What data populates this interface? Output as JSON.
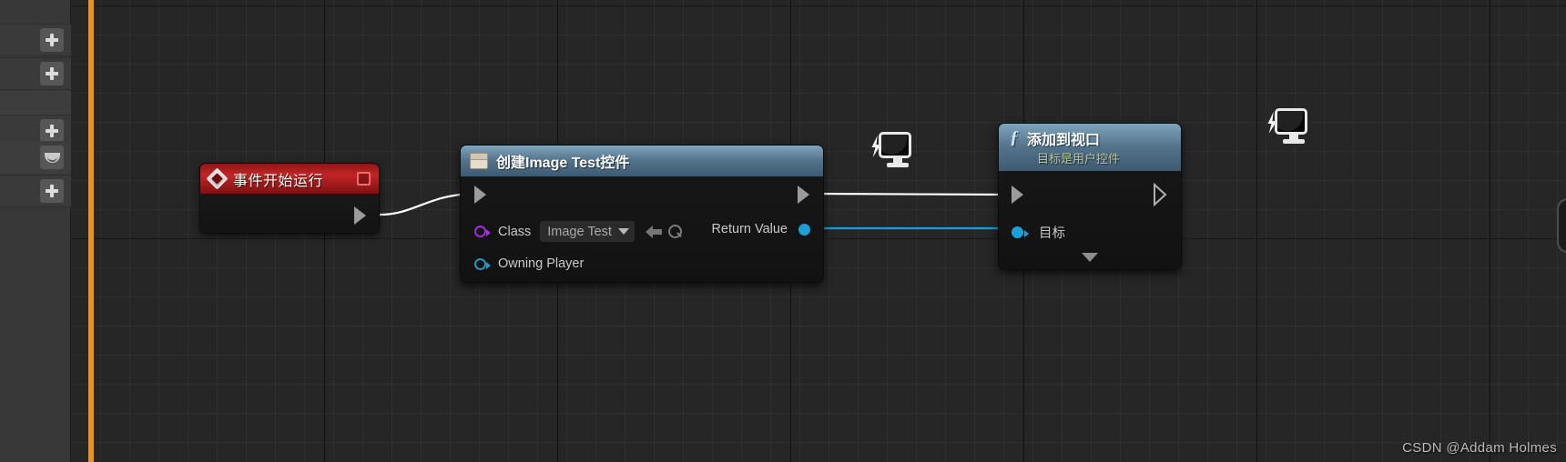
{
  "app": {
    "watermark": "CSDN @Addam Holmes"
  },
  "sidebar": {
    "items": [
      {
        "name": "add-row-1",
        "icon": "plus-icon"
      },
      {
        "name": "add-row-2",
        "icon": "plus-icon"
      },
      {
        "name": "spacer-row",
        "icon": "none"
      },
      {
        "name": "add-row-3",
        "icon": "plus-icon"
      },
      {
        "name": "visibility-row",
        "icon": "eye-icon"
      },
      {
        "name": "add-row-4",
        "icon": "plus-icon"
      }
    ]
  },
  "graph": {
    "axis_color": "#e8911c",
    "background_color": "#262626",
    "nodes": {
      "event": {
        "title": "事件开始运行",
        "icon": "event-diamond-icon",
        "badge": "breakpoint-square-icon",
        "exec_out": "exec-out-pin",
        "header_color": "#c22626"
      },
      "create_widget": {
        "title": "创建Image Test控件",
        "icon": "widget-icon",
        "header_color": "#54748c",
        "exec_in": "exec-in-pin",
        "exec_out": "exec-out-pin",
        "inputs": [
          {
            "label": "Class",
            "pin_type": "class",
            "pin_color": "#9b30d9",
            "value": "Image Test"
          },
          {
            "label": "Owning Player",
            "pin_type": "object",
            "pin_color": "#2596be",
            "value": ""
          }
        ],
        "outputs": [
          {
            "label": "Return Value",
            "pin_type": "object",
            "pin_color": "#1b9fd8"
          }
        ],
        "combo_caret": "chevron-down-icon",
        "reset_icon": "back-arrow-icon",
        "browse_icon": "search-icon",
        "debug_icon": "monitor-debug-icon"
      },
      "add_to_viewport": {
        "title": "添加到视口",
        "subtitle": "目标是用户控件",
        "icon": "function-fx-icon",
        "header_color": "#54748c",
        "exec_in": "exec-in-pin",
        "exec_out": "exec-out-pin",
        "inputs": [
          {
            "label": "目标",
            "pin_type": "object",
            "pin_color": "#1b9fd8"
          }
        ],
        "collapse_icon": "chevron-down-icon",
        "debug_icon": "monitor-debug-icon"
      }
    },
    "wires": [
      {
        "from": "event.exec_out",
        "to": "create_widget.exec_in",
        "color": "#ffffff",
        "type": "exec"
      },
      {
        "from": "create_widget.exec_out",
        "to": "add_to_viewport.exec_in",
        "color": "#ffffff",
        "type": "exec"
      },
      {
        "from": "create_widget.return_value",
        "to": "add_to_viewport.target",
        "color": "#1b9fd8",
        "type": "data"
      }
    ]
  }
}
